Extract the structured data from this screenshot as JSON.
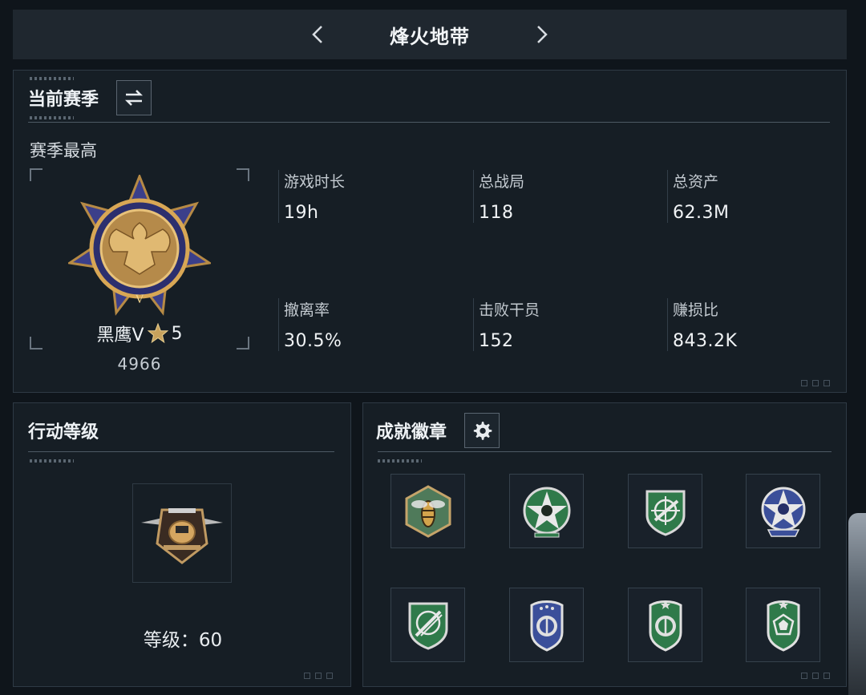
{
  "header": {
    "title": "烽火地带"
  },
  "season": {
    "title": "当前赛季",
    "subtitle": "赛季最高",
    "rank_name": "黑鹰V",
    "rank_stars": "5",
    "rank_score": "4966",
    "stats": [
      {
        "label": "游戏时长",
        "value": "19h"
      },
      {
        "label": "总战局",
        "value": "118"
      },
      {
        "label": "总资产",
        "value": "62.3M"
      },
      {
        "label": "撤离率",
        "value": "30.5%"
      },
      {
        "label": "击败干员",
        "value": "152"
      },
      {
        "label": "赚损比",
        "value": "843.2K"
      }
    ]
  },
  "level": {
    "title": "行动等级",
    "label": "等级：60"
  },
  "achievements": {
    "title": "成就徽章",
    "medals": [
      {
        "icon": "wasp-hexagon-badge-icon",
        "color": "#4f7a5a"
      },
      {
        "icon": "skull-star-badge-icon",
        "color": "#2f7a4a"
      },
      {
        "icon": "rifle-crosshair-shield-icon",
        "color": "#2f7a4a"
      },
      {
        "icon": "skull-star-blue-badge-icon",
        "color": "#3b4f9a"
      },
      {
        "icon": "crossed-missiles-shield-icon",
        "color": "#2f7a4a"
      },
      {
        "icon": "blue-shield-emblem-icon",
        "color": "#3b4f9a"
      },
      {
        "icon": "green-shield-emblem-icon",
        "color": "#2f7a4a"
      },
      {
        "icon": "green-gem-shield-icon",
        "color": "#2f7a4a"
      }
    ]
  }
}
